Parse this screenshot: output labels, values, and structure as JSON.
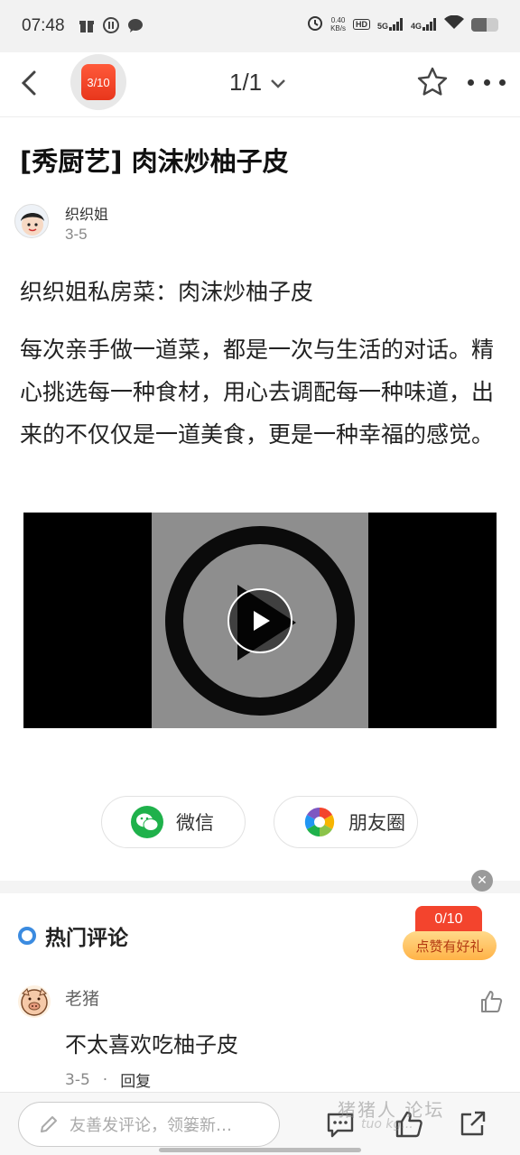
{
  "status_bar": {
    "time": "07:48",
    "net_speed_value": "0.40",
    "net_speed_unit": "KB/s",
    "hd_tag": "HD",
    "sim1_tag": "5G",
    "sim2_tag": "4G",
    "battery_level": 0.55,
    "left_icons": [
      "gift-icon",
      "app-badge-icon",
      "message-bubble-icon"
    ],
    "right_icons": [
      "alarm-icon",
      "hd-voice-icon",
      "signal-5g-icon",
      "signal-4g-icon",
      "wifi-icon",
      "battery-icon"
    ]
  },
  "nav": {
    "badge_text": "3/10",
    "page_indicator": "1/1",
    "icons": [
      "back-arrow-icon",
      "chevron-down-icon",
      "star-icon",
      "more-dots-icon"
    ]
  },
  "article": {
    "title": "[秀厨艺] 肉沫炒柚子皮",
    "author": "织织姐",
    "date": "3-5",
    "subtitle": "织织姐私房菜：肉沫炒柚子皮",
    "body": "每次亲手做一道菜，都是一次与生活的对话。精心挑选每一种食材，用心去调配每一种味道，出来的不仅仅是一道美食，更是一种幸福的感觉。"
  },
  "share": {
    "wechat_label": "微信",
    "moments_label": "朋友圈"
  },
  "comments_section": {
    "title": "热门评论",
    "like_progress": "0/10",
    "like_gift_label": "点赞有好礼",
    "close_glyph": "✕",
    "items": [
      {
        "user": "老猪",
        "text": "不太喜欢吃柚子皮",
        "date": "3-5",
        "separator": "·",
        "reply_label": "回复"
      }
    ]
  },
  "bottom_bar": {
    "comment_placeholder": "友善发评论，领篓新…",
    "watermark": "猪猪人 论坛",
    "watermark_sub": "tuo kg..."
  },
  "colors": {
    "accent_red": "#f3442d",
    "wechat_green": "#1fb14b",
    "comment_dot_blue": "#3b8be0"
  }
}
